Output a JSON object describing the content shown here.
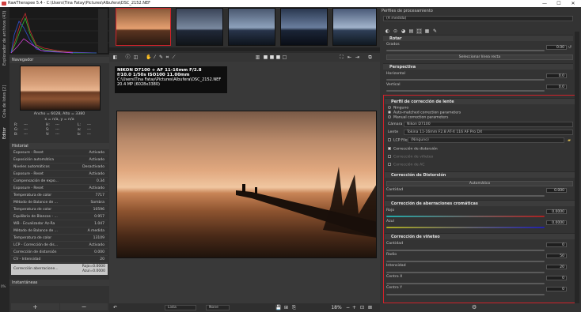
{
  "window": {
    "title": "RawTherapee 5.4 - C:\\Users\\Tina Fatay\\Pictures\\Albufera\\DSC_2152.NEF",
    "min": "—",
    "max": "☐",
    "close": "✕"
  },
  "left_tabs": [
    "Explorador de archivos (43)",
    "Cola de lotes [2]",
    "Editor"
  ],
  "navigator": {
    "title": "Navegador",
    "size_line": "Ancho = 6028, Alto = 3380",
    "coords_line": "x = n/a, y = n/a",
    "readouts": [
      "R:",
      "G:",
      "B:",
      "H:",
      "S:",
      "V:",
      "L:",
      "a:",
      "b:"
    ],
    "readout_value": "---"
  },
  "history": {
    "title": "Historial",
    "rows": [
      {
        "label": "Exposure - Reset",
        "value": "Activado"
      },
      {
        "label": "Exposición automática",
        "value": "Activado"
      },
      {
        "label": "Niveles automáticos",
        "value": "Desactivado"
      },
      {
        "label": "Exposure - Reset",
        "value": "Activado"
      },
      {
        "label": "Compensación de expo...",
        "value": "0.34"
      },
      {
        "label": "Exposure - Reset",
        "value": "Activado"
      },
      {
        "label": "Temperatura de color",
        "value": "7717"
      },
      {
        "label": "Método de Balance de ...",
        "value": "Sombra"
      },
      {
        "label": "Temperatura de color",
        "value": "10596"
      },
      {
        "label": "Equilibrio de Blancos - ...",
        "value": "0.957"
      },
      {
        "label": "WB - Ecualizador Az-Ra",
        "value": "1.047"
      },
      {
        "label": "Método de Balance de ...",
        "value": "A medida"
      },
      {
        "label": "Temperatura de color",
        "value": "13109"
      },
      {
        "label": "LCP - Corrección de dis...",
        "value": "Activado"
      },
      {
        "label": "Corrección de distorsión",
        "value": "0.000"
      },
      {
        "label": "CV - Intensidad",
        "value": "20"
      }
    ],
    "selected": {
      "label": "Corrección aberracione...",
      "value1": "Rojo=0.0000",
      "value2": "Azul=0.0000"
    }
  },
  "snapshots": {
    "title": "Instantáneas",
    "add": "+",
    "remove": "−"
  },
  "status_pct": "0%",
  "exif": {
    "line1": "NIKON D7100 + AF 11-16mm F/2.8",
    "line2": "f/10.0  1/50s  ISO100  11.00mm",
    "line3": "C:\\Users\\Tina Fatay\\Pictures\\Albufera\\DSC_2152.NEF",
    "line4": "20.4 MP (6028x3380)"
  },
  "bottombar": {
    "mode": "Lista",
    "preview": "None",
    "zoom": "18%"
  },
  "right": {
    "title": "Perfiles de procesamiento",
    "profile": "(A medida)",
    "rotate": {
      "title": "Rotar",
      "label": "Grados",
      "value": "0.00",
      "button": "Seleccionar línea recta"
    },
    "perspective": {
      "title": "Perspectiva",
      "h_label": "Horizontal",
      "h_value": "0.0",
      "v_label": "Vertical",
      "v_value": "0.0"
    },
    "lens": {
      "title": "Perfil de corrección de lente",
      "opt1": "Ninguno",
      "opt2": "Auto-matched correction parameters",
      "opt3": "Manual correction parameters",
      "camera_label": "Cámara",
      "camera": "Nikon D7100",
      "lens_label": "Lente",
      "lens": "Tokina 11-16mm F2.8 AT-X 116 AF Pro DX",
      "lcp_label": "LCP File",
      "lcp": "(Ninguno)",
      "c1": "Corrección de distorsión",
      "c2": "Corrección de viñeteo",
      "c3": "Corrección de AC"
    },
    "distortion": {
      "title": "Corrección de Distorsión",
      "button": "Automático",
      "label": "Cantidad",
      "value": "0.000"
    },
    "ca": {
      "title": "Corrección de aberraciones cromáticas",
      "red_label": "Rojo",
      "red_value": "0.0000",
      "blue_label": "Azul",
      "blue_value": "0.0000"
    },
    "vignette": {
      "title": "Corrección de viñeteo",
      "amount_label": "Cantidad",
      "amount_value": "0",
      "radius_label": "Radio",
      "radius_value": "50",
      "strength_label": "Intensidad",
      "strength_value": "20",
      "cx_label": "Centro X",
      "cx_value": "0",
      "cy_label": "Centro Y",
      "cy_value": "0"
    }
  },
  "colors": {
    "accent": "#3a7bd5",
    "highlight": "#d0222a"
  }
}
